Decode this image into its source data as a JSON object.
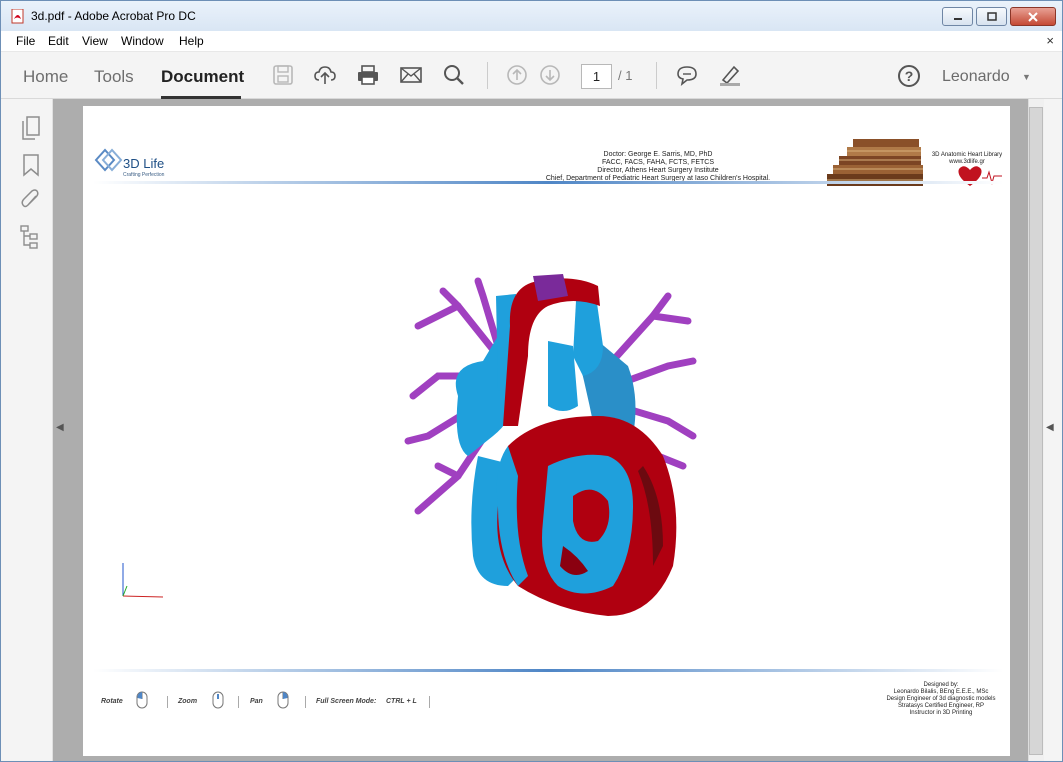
{
  "window": {
    "title": "3d.pdf - Adobe Acrobat Pro DC",
    "buttons": [
      "minimize",
      "maximize",
      "close"
    ]
  },
  "menubar": {
    "items": [
      "File",
      "Edit",
      "View",
      "Window",
      "Help"
    ],
    "close_glyph": "×"
  },
  "toolbar": {
    "tabs": [
      "Home",
      "Tools",
      "Document"
    ],
    "active_tab": "Document",
    "page_current": "1",
    "page_total": "/ 1",
    "user": "Leonardo",
    "help_glyph": "?"
  },
  "left_rail": {
    "icons": [
      "pages-icon",
      "bookmark-icon",
      "attachment-icon",
      "layers-icon"
    ]
  },
  "document": {
    "logo_title": "3D Life",
    "logo_subtitle": "Crafting Perfection",
    "header_lines": [
      "Doctor: George E. Sarris, MD, PhD",
      "FACC, FACS, FAHA, FCTS, FETCS",
      "Director, Athens Heart Surgery Institute",
      "Chief, Department of Pediatric Heart Surgery at Iaso Children's Hospital."
    ],
    "library_title": "3D Anatomic Heart Library",
    "library_url": "www.3dlife.gr",
    "controls": {
      "rotate": "Rotate",
      "zoom": "Zoom",
      "pan": "Pan",
      "fullscreen": "Full Screen Mode:",
      "fullscreen_keys": "CTRL + L"
    },
    "designer_lines": [
      "Designed by:",
      "Leonardo Bilalis, BEng E.E.E., MSc",
      "Design Engineer of 3d diagnostic models",
      "Stratasys Certified Engineer, RP",
      "Instructor in 3D Printing"
    ]
  },
  "colors": {
    "heart_red": "#b00010",
    "heart_blue": "#1fa0dc",
    "vessel_purple": "#a040c0",
    "accent_line": "#4f86c6"
  }
}
